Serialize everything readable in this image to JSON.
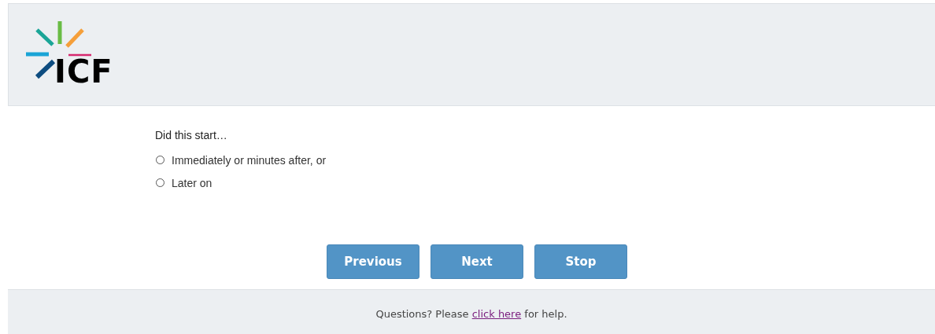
{
  "header": {
    "logo_text": "ICF"
  },
  "question": {
    "prompt": "Did this start…",
    "options": [
      {
        "label": "Immediately or minutes after, or",
        "selected": false
      },
      {
        "label": "Later on",
        "selected": false
      }
    ]
  },
  "buttons": [
    "Previous",
    "Next",
    "Stop"
  ],
  "footer": {
    "before": "Questions? Please ",
    "link": "click here",
    "after": " for help."
  }
}
